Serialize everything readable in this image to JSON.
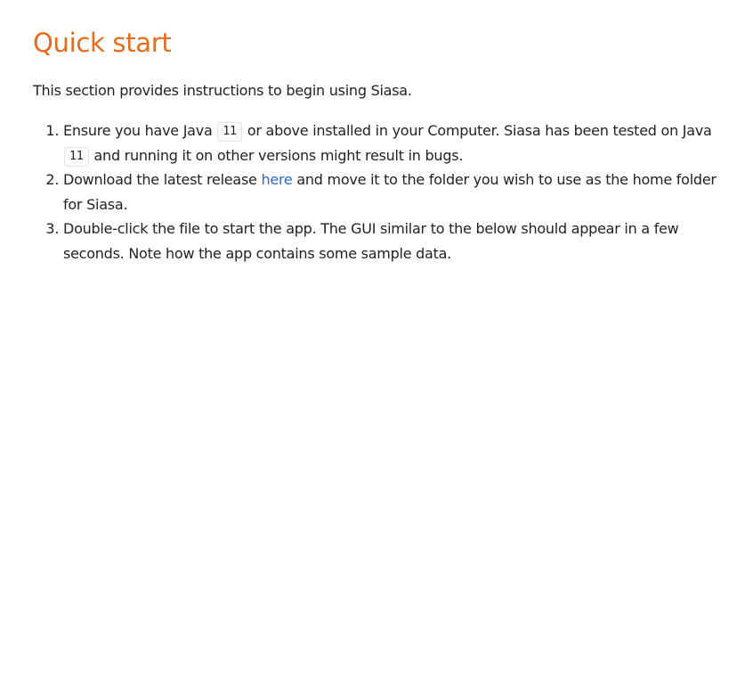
{
  "section": {
    "title": "Quick start",
    "intro": "This section provides instructions to begin using Siasa."
  },
  "steps": [
    {
      "part1": "Ensure you have Java ",
      "code1": "11",
      "part2": " or above installed in your Computer. Siasa has been tested on Java ",
      "code2": "11",
      "part3": " and running it on other versions might result in bugs."
    },
    {
      "part1": "Download the latest release ",
      "link": "here",
      "part2": " and move it to the folder you wish to use as the home folder for Siasa."
    },
    {
      "text": "Double-click the file to start the app. The GUI similar to the below should appear in a few seconds. Note how the app contains some sample data."
    }
  ],
  "colors": {
    "heading": "#e46c1e",
    "link": "#2a6bbf",
    "text": "#222222"
  }
}
